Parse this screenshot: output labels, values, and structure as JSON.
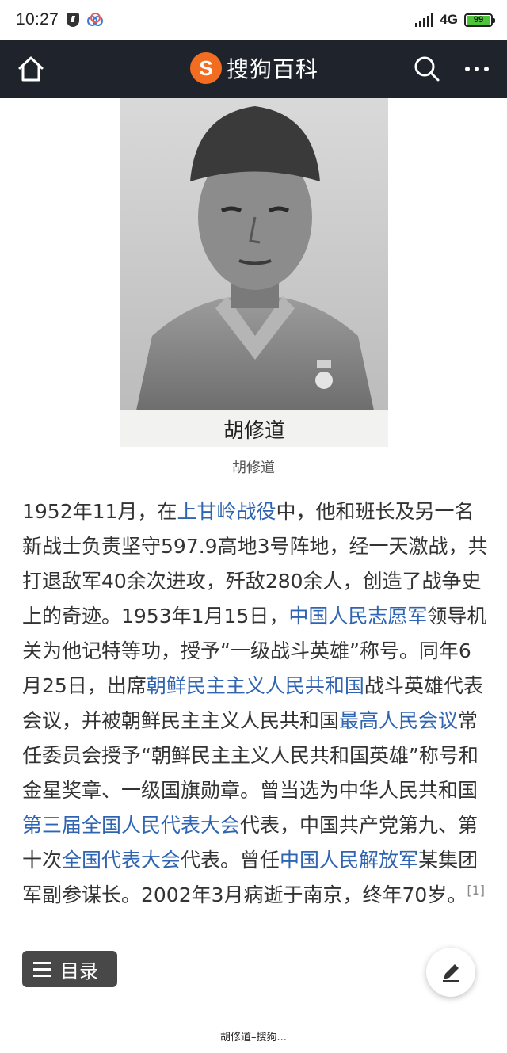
{
  "status_bar": {
    "time": "10:27",
    "network": "4G",
    "battery": "99"
  },
  "header": {
    "logo_mark": "S",
    "logo_text": "搜狗百科"
  },
  "figure": {
    "image_label": "胡修道",
    "caption": "胡修道"
  },
  "article": {
    "segments": [
      {
        "type": "text",
        "text": "1952年11月，在"
      },
      {
        "type": "link",
        "text": "上甘岭战役"
      },
      {
        "type": "text",
        "text": "中，他和班长及另一名新战士负责坚守597.9高地3号阵地，经一天激战，共打退敌军40余次进攻，歼敌280余人，创造了战争史上的奇迹。1953年1月15日，"
      },
      {
        "type": "link",
        "text": "中国人民志愿军"
      },
      {
        "type": "text",
        "text": "领导机关为他记特等功，授予“一级战斗英雄”称号。同年6月25日，出席"
      },
      {
        "type": "link",
        "text": "朝鲜民主主义人民共和国"
      },
      {
        "type": "text",
        "text": "战斗英雄代表会议，并被朝鲜民主主义人民共和国"
      },
      {
        "type": "link",
        "text": "最高人民会议"
      },
      {
        "type": "text",
        "text": "常任委员会授予“朝鲜民主主义人民共和国英雄”称号和金星奖章、一级国旗勋章。曾当选为中华人民共和国"
      },
      {
        "type": "link",
        "text": "第三届全国人民代表大会"
      },
      {
        "type": "text",
        "text": "代表，中国共产党第九、第十次"
      },
      {
        "type": "link",
        "text": "全国代表大会"
      },
      {
        "type": "text",
        "text": "代表。曾任"
      },
      {
        "type": "link",
        "text": "中国人民解放军"
      },
      {
        "type": "text",
        "text": "某集团军副参谋长。2002年3月病逝于南京，终年70岁。"
      }
    ],
    "reference": "[1]"
  },
  "toc": {
    "label": "目录"
  },
  "footer": {
    "tag": "胡修道–搜狗..."
  },
  "colors": {
    "header_bg": "#1f242c",
    "link": "#2f64b3",
    "logo": "#f36d21"
  }
}
